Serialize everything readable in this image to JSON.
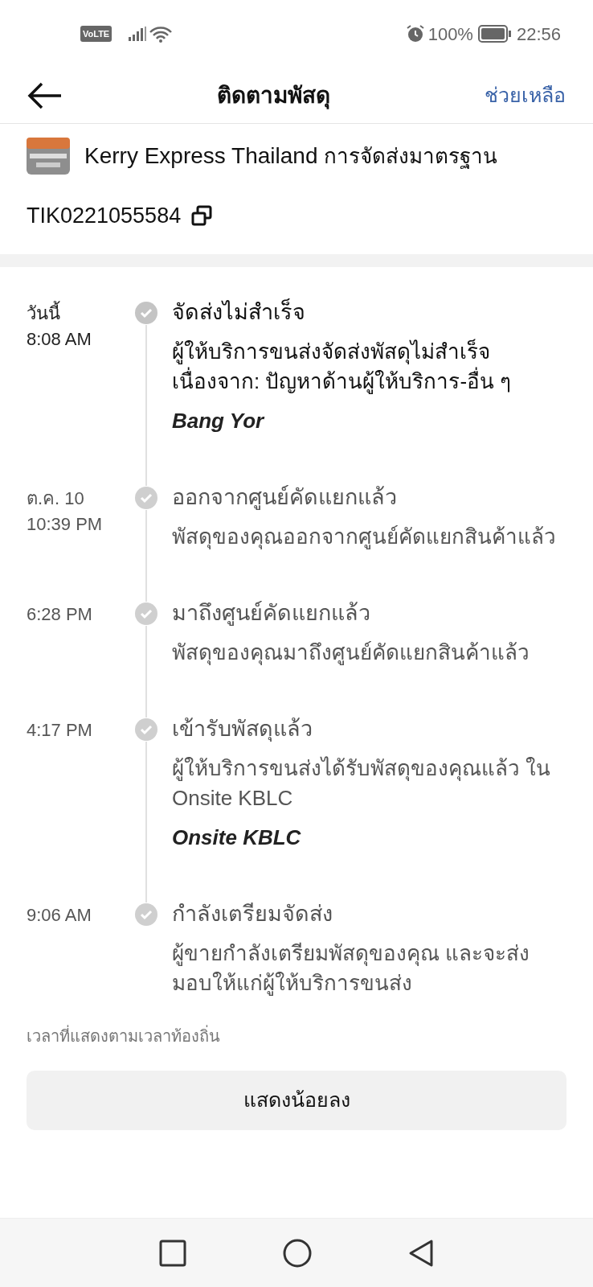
{
  "status_bar": {
    "network_badge": "VoLTE",
    "battery": "100%",
    "time": "22:56"
  },
  "header": {
    "title": "ติดตามพัสดุ",
    "help": "ช่วยเหลือ"
  },
  "courier": {
    "name": "Kerry Express Thailand",
    "service": "การจัดส่งมาตรฐาน",
    "tracking_number": "TIK0221055584"
  },
  "events": [
    {
      "date": "วันนี้",
      "time": "8:08 AM",
      "title": "จัดส่งไม่สำเร็จ",
      "description": "ผู้ให้บริการขนส่งจัดส่งพัสดุไม่สำเร็จ เนื่องจาก: ปัญหาด้านผู้ให้บริการ-อื่น ๆ",
      "location": "Bang Yor",
      "current": true
    },
    {
      "date": "ต.ค. 10",
      "time": "10:39 PM",
      "title": "ออกจากศูนย์คัดแยกแล้ว",
      "description": "พัสดุของคุณออกจากศูนย์คัดแยกสินค้าแล้ว",
      "current": false
    },
    {
      "time": "6:28 PM",
      "title": "มาถึงศูนย์คัดแยกแล้ว",
      "description": "พัสดุของคุณมาถึงศูนย์คัดแยกสินค้าแล้ว",
      "current": false
    },
    {
      "time": "4:17 PM",
      "title": "เข้ารับพัสดุแล้ว",
      "description": "ผู้ให้บริการขนส่งได้รับพัสดุของคุณแล้ว ใน Onsite KBLC",
      "location": "Onsite KBLC",
      "current": false
    },
    {
      "time": "9:06 AM",
      "title": "กำลังเตรียมจัดส่ง",
      "description": "ผู้ขายกำลังเตรียมพัสดุของคุณ และจะส่งมอบให้แก่ผู้ให้บริการขนส่ง",
      "current": false
    }
  ],
  "footnote": "เวลาที่แสดงตามเวลาท้องถิ่น",
  "show_less_button": "แสดงน้อยลง"
}
